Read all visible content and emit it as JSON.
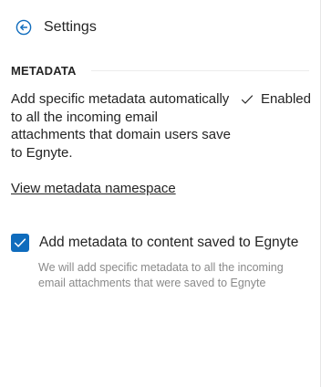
{
  "header": {
    "title": "Settings",
    "back_icon": "back-arrow-circle-icon"
  },
  "section": {
    "title": "METADATA"
  },
  "description": {
    "text": "Add specific metadata automatically to all the incoming email attachments that domain users save to Egnyte.",
    "status_label": "Enabled",
    "status_icon": "checkmark-icon"
  },
  "links": {
    "view_namespace": "View metadata namespace"
  },
  "option": {
    "checked": true,
    "label": "Add metadata to content saved to Egnyte",
    "help": "We will add specific metadata to all the incoming email attachments that were saved to Egnyte"
  },
  "colors": {
    "accent": "#0f6cbd",
    "text": "#242424",
    "muted": "#8a8a8a"
  }
}
